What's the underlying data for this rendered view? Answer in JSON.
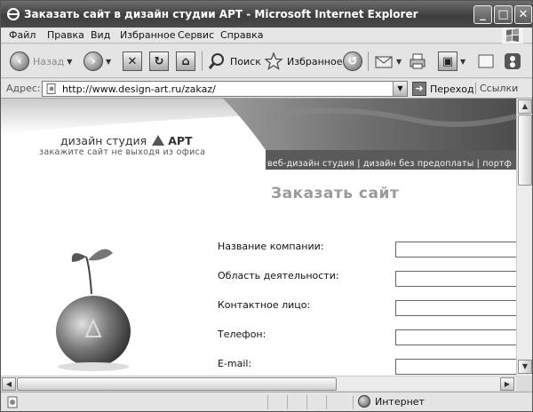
{
  "window": {
    "title": "Заказать сайт в дизайн студии АРТ - Microsoft Internet Explorer",
    "minimize_label": "_",
    "maximize_label": "□",
    "close_label": "✕"
  },
  "menu": {
    "items": [
      {
        "label": "Файл"
      },
      {
        "label": "Правка"
      },
      {
        "label": "Вид"
      },
      {
        "label": "Избранное"
      },
      {
        "label": "Сервис"
      },
      {
        "label": "Справка"
      }
    ]
  },
  "toolbar": {
    "back_label": "Назад",
    "search_label": "Поиск",
    "favorites_label": "Избранное"
  },
  "address": {
    "label": "Адрес:",
    "url": "http://www.design-art.ru/zakaz/",
    "go_label": "Переход",
    "links_label": "Ссылки"
  },
  "site": {
    "logo_text": "дизайн студия",
    "logo_brand": "АРТ",
    "tagline": "закажите сайт не выходя из офиса",
    "nav_text": "веб-дизайн студия | дизайн без предоплаты | портф",
    "heading": "Заказать сайт",
    "form_fields": [
      {
        "label": "Название компании:",
        "value": ""
      },
      {
        "label": "Область деятельности:",
        "value": ""
      },
      {
        "label": "Контактное лицо:",
        "value": ""
      },
      {
        "label": "Телефон:",
        "value": ""
      },
      {
        "label": "E-mail:",
        "value": ""
      }
    ]
  },
  "status": {
    "zone_label": "Интернет"
  }
}
